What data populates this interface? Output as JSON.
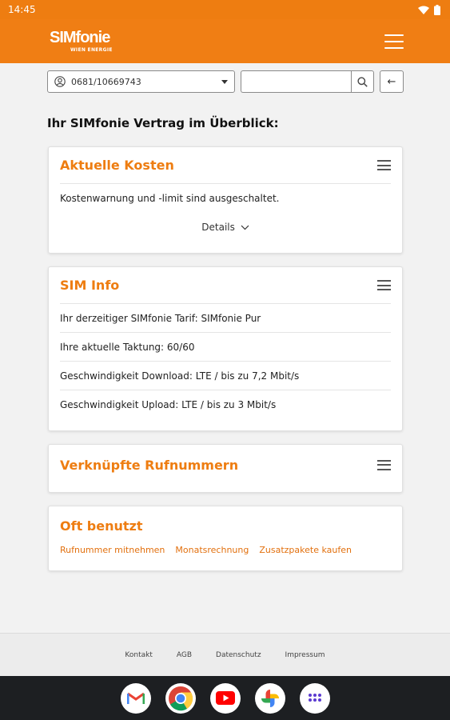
{
  "statusbar": {
    "time": "14:45"
  },
  "header": {
    "logo_main": "SIMfonie",
    "logo_sub": "WIEN ENERGIE"
  },
  "toolbar": {
    "number_select": "0681/10669743",
    "search_placeholder": "",
    "back_label": "←"
  },
  "page": {
    "title": "Ihr SIMfonie Vertrag im Überblick:"
  },
  "costs": {
    "title": "Aktuelle Kosten",
    "text": "Kostenwarnung und -limit sind ausgeschaltet.",
    "details_label": "Details"
  },
  "sim_info": {
    "title": "SIM Info",
    "rows": [
      "Ihr derzeitiger SIMfonie Tarif: SIMfonie Pur",
      "Ihre aktuelle Taktung: 60/60",
      "Geschwindigkeit Download: LTE / bis zu 7,2 Mbit/s",
      "Geschwindigkeit Upload: LTE / bis zu 3 Mbit/s"
    ]
  },
  "linked": {
    "title": "Verknüpfte Rufnummern"
  },
  "frequent": {
    "title": "Oft benutzt",
    "links": [
      "Rufnummer mitnehmen",
      "Monatsrechnung",
      "Zusatzpakete kaufen"
    ]
  },
  "footer": {
    "links": [
      "Kontakt",
      "AGB",
      "Datenschutz",
      "Impressum"
    ]
  },
  "dock": {
    "apps": [
      "gmail-icon",
      "chrome-icon",
      "youtube-icon",
      "photos-icon",
      "app-drawer-icon"
    ]
  },
  "colors": {
    "brand_orange": "#f07e14",
    "title_orange": "#ee7d11",
    "nav_dark": "#1d1f22"
  }
}
